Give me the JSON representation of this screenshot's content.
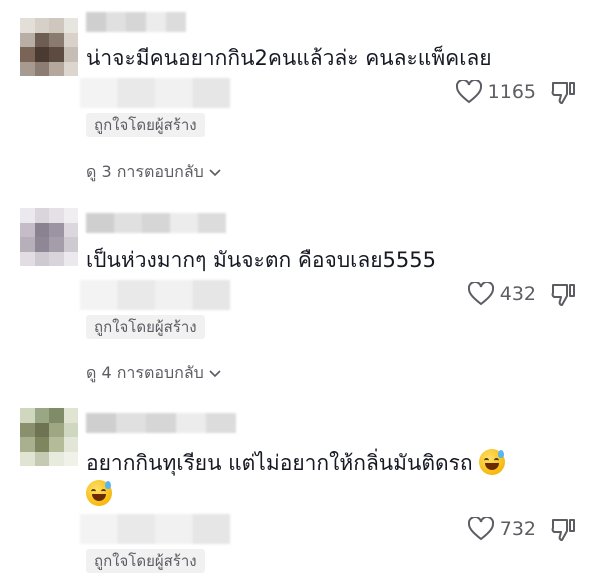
{
  "comments": [
    {
      "text": "น่าจะมีคนอยากกิน2คนแล้วล่ะ คนละแพ็คเลย",
      "likes": "1165",
      "liked_by_creator": "ถูกใจโดยผู้สร้าง",
      "replies_label": "ดู 3 การตอบกลับ",
      "avatar_colors": [
        "#e3ded8",
        "#d6d0c9",
        "#cfc6bd",
        "#e8e4df",
        "#b9aea6",
        "#6e5d52",
        "#8a7b70",
        "#d9d2cb",
        "#7a6457",
        "#4a3a31",
        "#5d4a40",
        "#c6bdb5",
        "#a79a90",
        "#8c7c72",
        "#b3a79e",
        "#ddd6cf"
      ]
    },
    {
      "text": "เป็นห่วงมากๆ มันจะตก คือจบเลย5555",
      "likes": "432",
      "liked_by_creator": "ถูกใจโดยผู้สร้าง",
      "replies_label": "ดู 4 การตอบกลับ",
      "avatar_colors": [
        "#ece9ee",
        "#dad5dc",
        "#e4e0e6",
        "#f1eef2",
        "#c4bcc6",
        "#8a8291",
        "#9d94a3",
        "#dcd7de",
        "#b7afba",
        "#8f8796",
        "#a59daa",
        "#cfc9d2",
        "#e1dde3",
        "#cfc9d2",
        "#d9d4db",
        "#ece9ee"
      ]
    },
    {
      "text_line1": "อยากกินทุเรียน แต่ไม่อยากให้กลิ่นมันติดรถ",
      "emoji_icon": "sweat-smile-emoji",
      "likes": "732",
      "liked_by_creator": "ถูกใจโดยผู้สร้าง",
      "avatar_colors": [
        "#cfd8bf",
        "#9aa784",
        "#7f8c67",
        "#dfe4d3",
        "#8a8f6e",
        "#6d7353",
        "#9ea782",
        "#d0d7c0",
        "#a9b08f",
        "#7e865f",
        "#b4bb99",
        "#e2e6d6",
        "#dfe4d3",
        "#c5cbb2",
        "#e7eadc",
        "#f0f2ea"
      ]
    }
  ],
  "colors": {
    "text": "#161823",
    "secondary": "#5c5c63",
    "badge_bg": "#f1f1f2"
  }
}
